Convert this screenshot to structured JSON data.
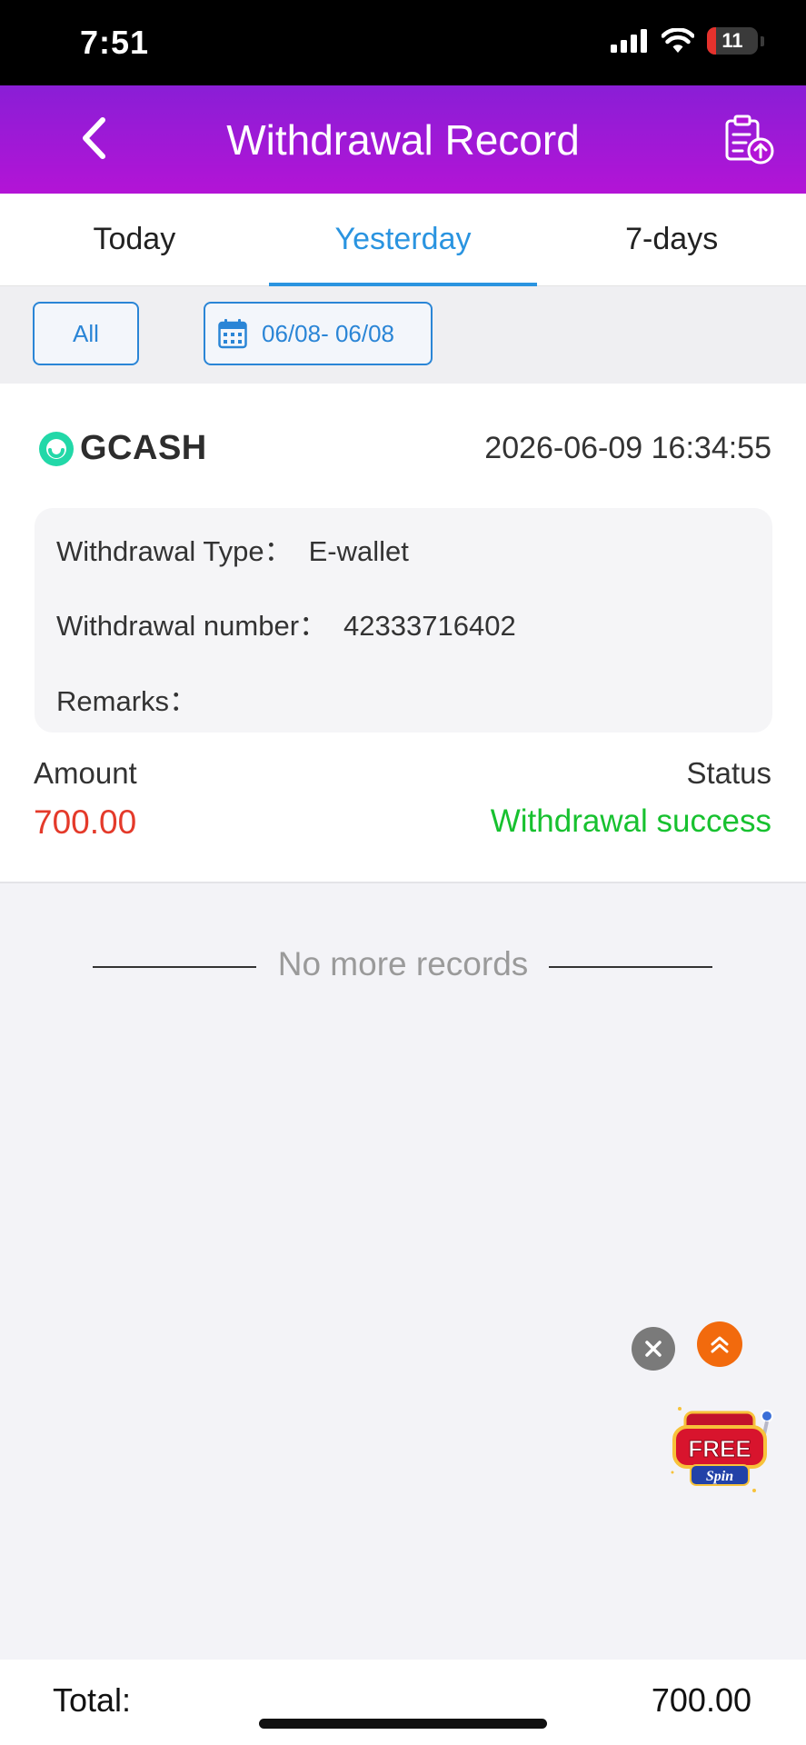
{
  "status_bar": {
    "time": "7:51",
    "battery": "11"
  },
  "header": {
    "title": "Withdrawal Record"
  },
  "tabs": [
    {
      "label": "Today",
      "active": false
    },
    {
      "label": "Yesterday",
      "active": true
    },
    {
      "label": "7-days",
      "active": false
    }
  ],
  "filters": {
    "type_label": "All",
    "date_range": "06/08- 06/08"
  },
  "record": {
    "provider": "GCASH",
    "datetime": "2026-06-09 16:34:55",
    "type_label": "Withdrawal Type：",
    "type_value": "E-wallet",
    "number_label": "Withdrawal number：",
    "number_value": "42333716402",
    "remarks_label": "Remarks：",
    "amount_label": "Amount",
    "amount_value": "700.00",
    "status_label": "Status",
    "status_value": "Withdrawal success"
  },
  "list_end_text": "No more records",
  "promo": {
    "line1": "FREE",
    "line2": "Spin"
  },
  "footer": {
    "total_label": "Total:",
    "total_value": "700.00"
  },
  "colors": {
    "header_gradient_start": "#8a1ed6",
    "header_gradient_end": "#b314d6",
    "accent_blue": "#2a94e0",
    "amount_red": "#e43a2a",
    "success_green": "#17c12f"
  }
}
